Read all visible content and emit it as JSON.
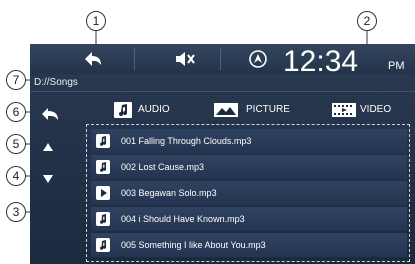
{
  "status": {
    "time": "12:34",
    "ampm": "PM"
  },
  "path": "D://Songs",
  "tabs": [
    {
      "label": "AUDIO",
      "icon": "music-note-icon"
    },
    {
      "label": "PICTURE",
      "icon": "picture-icon"
    },
    {
      "label": "VIDEO",
      "icon": "film-icon"
    }
  ],
  "files": [
    {
      "name": "001  Falling Through Clouds.mp3",
      "icon": "music-note-icon"
    },
    {
      "name": "002  Lost Cause.mp3",
      "icon": "music-note-icon"
    },
    {
      "name": "003  Begawan Solo.mp3",
      "icon": "play-icon"
    },
    {
      "name": "004  i Should Have Known.mp3",
      "icon": "music-note-icon"
    },
    {
      "name": "005  Something I like About You.mp3",
      "icon": "music-note-icon"
    }
  ],
  "callouts": [
    "1",
    "2",
    "3",
    "4",
    "5",
    "6",
    "7"
  ],
  "colors": {
    "screen_bg": "#1c2a3e",
    "row_bg": "#2a3c58",
    "text": "#ffffff"
  }
}
